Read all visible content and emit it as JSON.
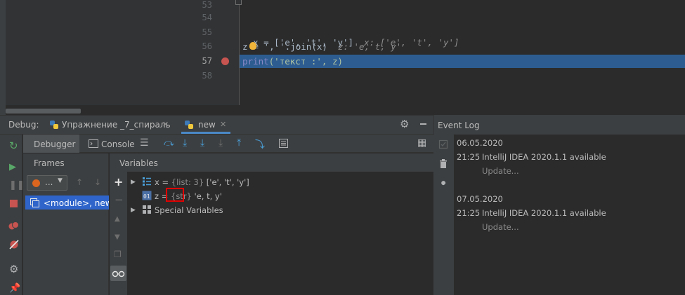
{
  "editor": {
    "lines": [
      {
        "num": "53",
        "code": ""
      },
      {
        "num": "54",
        "code": ""
      },
      {
        "num": "55",
        "code": "x = ['e', 't', 'y']",
        "inline": "x: ['e', 't', 'y']"
      },
      {
        "num": "56",
        "code_a": "z",
        "code_b": "= ', '.join(x)",
        "inline": "z: 'e, t, y'"
      },
      {
        "num": "57",
        "code_fn": "print",
        "code_args": "('текст :', z)"
      },
      {
        "num": "58",
        "code": ""
      }
    ]
  },
  "debug": {
    "label": "Debug:",
    "tabs": [
      {
        "label": "Упражнение _7_спираль"
      },
      {
        "label": "new"
      }
    ],
    "subtabs": {
      "debugger": "Debugger",
      "console": "Console"
    },
    "frames": {
      "title": "Frames",
      "thread_label": "...",
      "frame": "<module>, new.p"
    },
    "variables": {
      "title": "Variables",
      "rows": [
        {
          "name": "x",
          "type": "{list: 3}",
          "value": "['e', 't', 'y']"
        },
        {
          "name": "z",
          "type": "{str}",
          "value": "'e, t, y'"
        },
        {
          "name": "Special Variables"
        }
      ]
    }
  },
  "event_log": {
    "title": "Event Log",
    "entries": [
      {
        "date": "06.05.2020",
        "time": "21:25",
        "message": "IntelliJ IDEA 2020.1.1 available",
        "link": "Update..."
      },
      {
        "date": "07.05.2020",
        "time": "21:25",
        "message": "IntelliJ IDEA 2020.1.1 available",
        "link": "Update..."
      }
    ]
  },
  "colors": {
    "accent": "#4a88c7",
    "execution_line": "#2d5c91",
    "breakpoint": "#c75450",
    "highlight_box": "#e00000"
  }
}
